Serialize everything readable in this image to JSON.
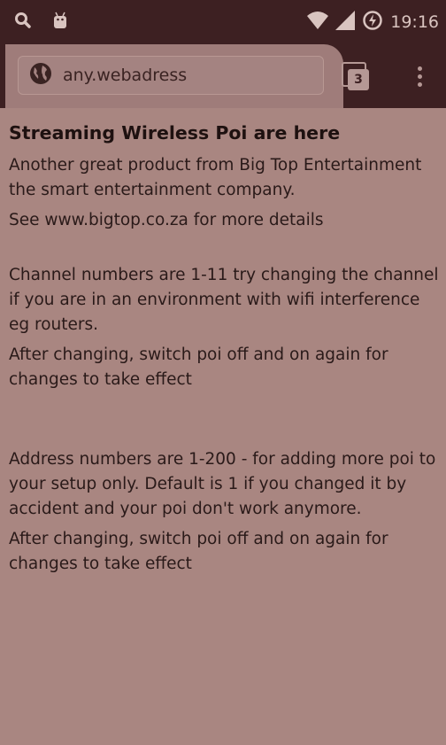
{
  "status_bar": {
    "time": "19:16",
    "left_icons": [
      "search-icon",
      "android-icon"
    ],
    "right_icons": [
      "wifi-icon",
      "signal-icon",
      "data-saver-icon"
    ]
  },
  "browser": {
    "url": "any.webadress",
    "tab_count": "3"
  },
  "page": {
    "title": "Streaming Wireless Poi are here",
    "intro": "Another great product from Big Top Entertainment the smart entertainment company.",
    "details": "See www.bigtop.co.za for more details",
    "channel_info": "Channel numbers are 1-11 try changing the channel if you are in an environment with wifi interference eg routers.",
    "channel_note": "After changing, switch poi off and on again for changes to take effect",
    "address_info": "Address numbers are 1-200 - for adding more poi to your setup only. Default is 1 if you changed it by accident and your poi don't work anymore.",
    "address_note": "After changing, switch poi off and on again for changes to take effect"
  },
  "colors": {
    "status_bar_bg": "#3d2022",
    "page_bg": "#a98681",
    "text": "#2a1a19"
  }
}
